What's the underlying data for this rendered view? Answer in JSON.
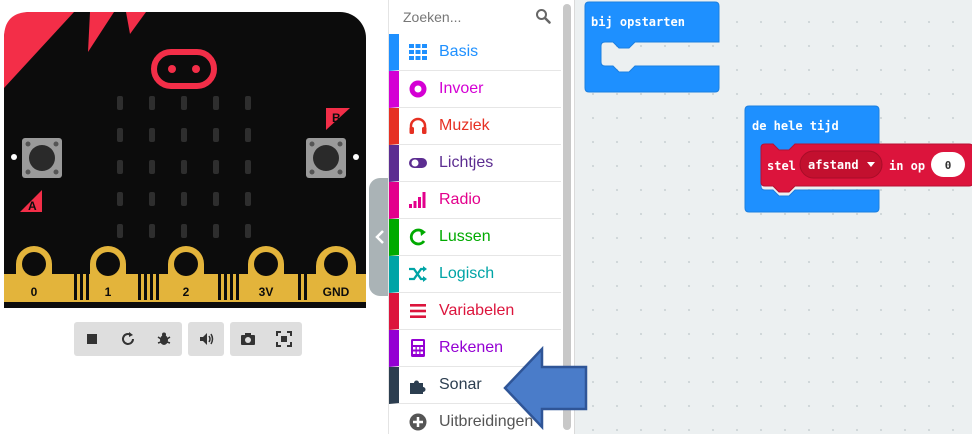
{
  "search": {
    "placeholder": "Zoeken..."
  },
  "categories": [
    {
      "id": "basis",
      "label": "Basis",
      "color": "#1e90ff",
      "icon": "grid-icon"
    },
    {
      "id": "invoer",
      "label": "Invoer",
      "color": "#d400d4",
      "icon": "target-icon"
    },
    {
      "id": "muziek",
      "label": "Muziek",
      "color": "#e63022",
      "icon": "headphones-icon"
    },
    {
      "id": "lichtjes",
      "label": "Lichtjes",
      "color": "#5c2d91",
      "icon": "toggle-icon"
    },
    {
      "id": "radio",
      "label": "Radio",
      "color": "#e3008c",
      "icon": "signal-bars-icon"
    },
    {
      "id": "lussen",
      "label": "Lussen",
      "color": "#00aa00",
      "icon": "loop-icon"
    },
    {
      "id": "logisch",
      "label": "Logisch",
      "color": "#00a4a6",
      "icon": "shuffle-icon"
    },
    {
      "id": "variabelen",
      "label": "Variabelen",
      "color": "#dc143c",
      "icon": "list-icon"
    },
    {
      "id": "rekenen",
      "label": "Rekenen",
      "color": "#9400d3",
      "icon": "calculator-icon"
    },
    {
      "id": "sonar",
      "label": "Sonar",
      "color": "#2c3e50",
      "icon": "puzzle-icon"
    },
    {
      "id": "uitbreidingen",
      "label": "Uitbreidingen",
      "color": "#555555",
      "icon": "plus-circle-icon"
    }
  ],
  "board": {
    "pins": [
      "0",
      "1",
      "2",
      "3V",
      "GND"
    ],
    "button_a": "A",
    "button_b": "B",
    "colors": {
      "body": "#0c0c0c",
      "accent": "#f32e48",
      "pins": "#e3b43b"
    }
  },
  "sim_toolbar": {
    "icons": [
      "stop-icon",
      "restart-icon",
      "debug-icon",
      "sound-icon",
      "screenshot-icon",
      "fullscreen-icon"
    ]
  },
  "workspace": {
    "on_start": {
      "label": "bij opstarten",
      "color": "#1e90ff"
    },
    "forever": {
      "label": "de hele tijd",
      "color": "#1e90ff"
    },
    "set_block": {
      "keyword": "stel",
      "variable": "afstand",
      "to": "in op",
      "value": "0",
      "color": "#dc143c"
    }
  }
}
